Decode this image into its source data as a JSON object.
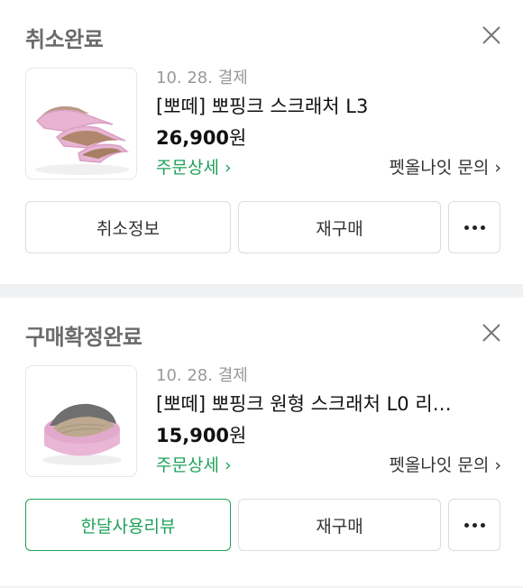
{
  "orders": [
    {
      "status": "취소완료",
      "date": "10. 28. 결제",
      "product_name": "[뽀떼] 뽀핑크 스크래처 L3",
      "price": "26,900",
      "currency": "원",
      "detail_link": "주문상세 ›",
      "inquiry_link": "펫올나잇 문의 ›",
      "actions": {
        "left": "취소정보",
        "middle": "재구매"
      }
    },
    {
      "status": "구매확정완료",
      "date": "10. 28. 결제",
      "product_name": "[뽀떼] 뽀핑크 원형 스크래처 L0 리…",
      "price": "15,900",
      "currency": "원",
      "detail_link": "주문상세 ›",
      "inquiry_link": "펫올나잇 문의 ›",
      "actions": {
        "left": "한달사용리뷰",
        "middle": "재구매"
      }
    }
  ],
  "colors": {
    "accent_green": "#1fa15a",
    "status_gray": "#6b6b6b",
    "separator": "#f0f1f3"
  },
  "icons": {
    "close": "close-icon",
    "more": "more-dots-icon"
  }
}
